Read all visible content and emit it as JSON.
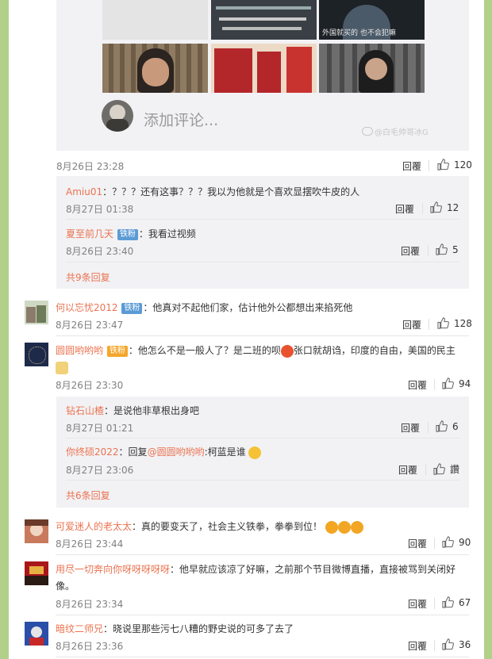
{
  "top_post": {
    "image_captions": [
      "外国就买的 也不会犯嘛"
    ],
    "comment_placeholder": "添加评论...",
    "watermark": "@白毛帅哥冰G",
    "timestamp": "8月26日 23:28",
    "reply_label": "回覆",
    "like_count": "120"
  },
  "threads": [
    {
      "id": "amiu",
      "replies": [
        {
          "user": "Amiu01",
          "badge": "",
          "text": "：？？？还有这事？？？我以为他就是个喜欢显摆吹牛皮的人",
          "time": "8月27日 01:38",
          "reply_label": "回覆",
          "likes": "12"
        },
        {
          "user": "夏至前几天",
          "badge": "铁粉",
          "text": "：我看过视频",
          "time": "8月26日 23:40",
          "reply_label": "回覆",
          "likes": "5"
        }
      ],
      "more": "共9条回复"
    }
  ],
  "comments": [
    {
      "user": "何以忘忧2012",
      "badge": "铁粉",
      "text": "：他真对不起他们家，估计他外公都想出来掐死他",
      "time": "8月26日 23:47",
      "reply_label": "回覆",
      "likes": "128"
    },
    {
      "user": "圆圆哟哟哟",
      "badge": "铁粉",
      "text_a": "：他怎么不是一般人了？是二班的呗",
      "text_b": "张口就胡诌，印度的自由，美国的民主",
      "time": "8月26日 23:30",
      "reply_label": "回覆",
      "likes": "94"
    },
    {
      "user": "可爱迷人的老太太",
      "badge": "",
      "text": "：真的要变天了，社会主义铁拳，拳拳到位！",
      "time": "8月26日 23:44",
      "reply_label": "回覆",
      "likes": "90"
    },
    {
      "user": "用尽一切奔向你呀呀呀呀呀",
      "badge": "",
      "text": "：他早就应该凉了好嘛，之前那个节目微博直播，直接被骂到关闭好像。",
      "time": "8月26日 23:34",
      "reply_label": "回覆",
      "likes": "67"
    },
    {
      "user": "暗纹二师兄",
      "badge": "",
      "text": "：晓说里那些污七八糟的野史说的可多了去了",
      "time": "8月26日 23:36",
      "reply_label": "回覆",
      "likes": "36"
    }
  ],
  "thread2": {
    "replies": [
      {
        "user": "钻石山楂",
        "text": "：是说他非草根出身吧",
        "time": "8月27日 01:21",
        "reply_label": "回覆",
        "likes": "6"
      },
      {
        "user": "你终硕2022",
        "text_a": "：回复",
        "mention": "@圆圆哟哟哟",
        "text_b": ":柯蓝是谁",
        "time": "8月27日 23:06",
        "reply_label": "回覆",
        "likes": "讚"
      }
    ],
    "more": "共6条回复"
  }
}
